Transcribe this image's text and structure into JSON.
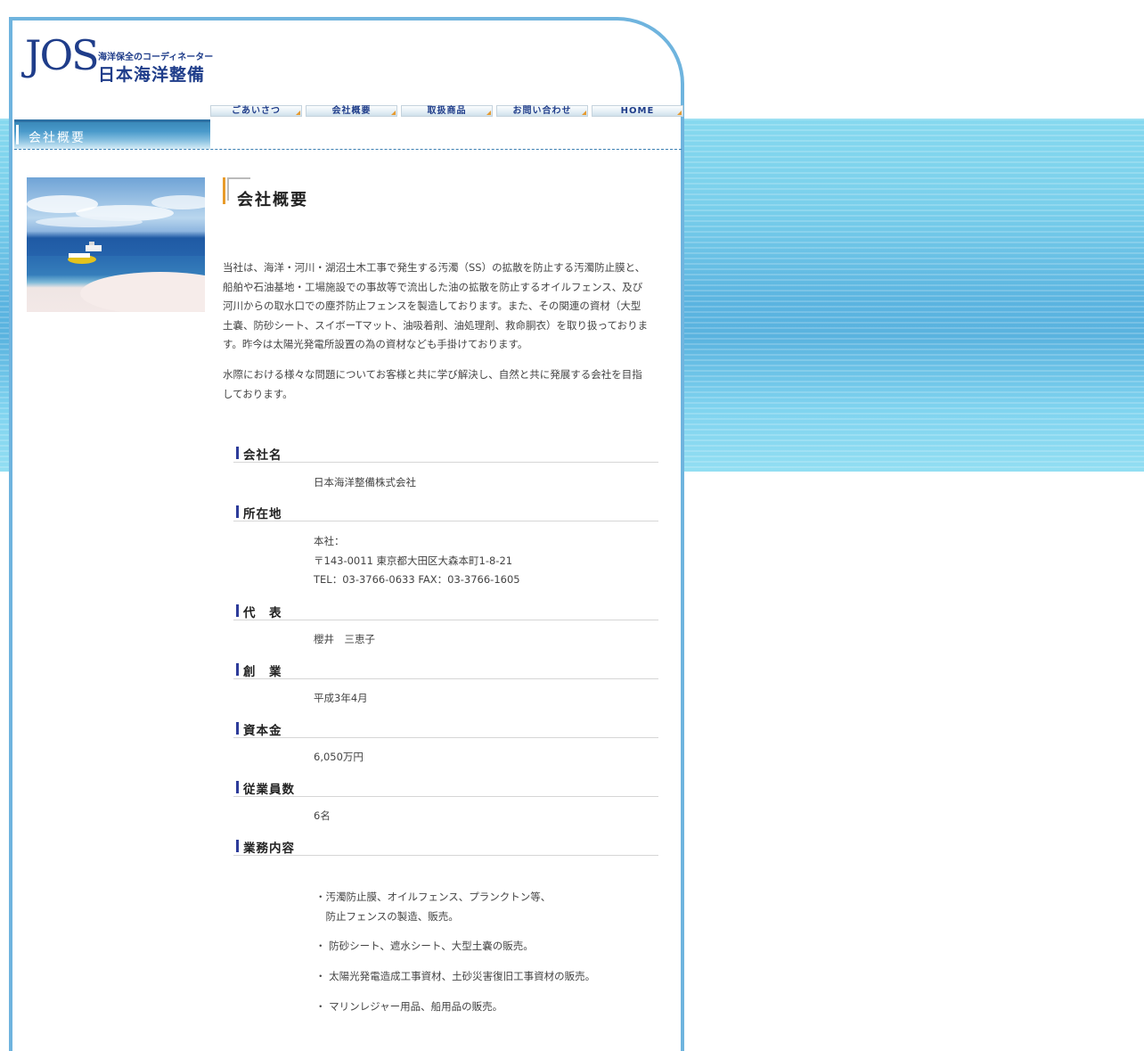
{
  "logo": {
    "mark": "JOS",
    "tagline": "海洋保全のコーディネーター",
    "company": "日本海洋整備"
  },
  "nav": {
    "items": [
      {
        "label": "ごあいさつ"
      },
      {
        "label": "会社概要"
      },
      {
        "label": "取扱商品"
      },
      {
        "label": "お問い合わせ"
      },
      {
        "label": "HOME"
      }
    ]
  },
  "section_header": "会社概要",
  "page_title": "会社概要",
  "intro": {
    "paragraph1": "当社は、海洋・河川・湖沼土木工事で発生する汚濁（SS）の拡散を防止する汚濁防止膜と、\n船舶や石油基地・工場施設での事故等で流出した油の拡散を防止するオイルフェンス、及び\n河川からの取水口での塵芥防止フェンスを製造しております。また、その関連の資材（大型\n土嚢、防砂シート、スイボーTマット、油吸着剤、油処理剤、救命胴衣）を取り扱っておりま\nす。昨今は太陽光発電所設置の為の資材なども手掛けております。",
    "paragraph2": "水際における様々な問題についてお客様と共に学び解決し、自然と共に発展する会社を目指\nしております。"
  },
  "info": {
    "company_name": {
      "label": "会社名",
      "value": "日本海洋整備株式会社"
    },
    "address": {
      "label": "所在地",
      "line1": "本社：",
      "line2": "〒143-0011 東京都大田区大森本町1-8-21",
      "line3": "TEL：03‐3766‐0633 FAX：03‐3766‐1605"
    },
    "representative": {
      "label": "代　表",
      "value": "櫻井　三恵子"
    },
    "founded": {
      "label": "創　業",
      "value": "平成3年4月"
    },
    "capital": {
      "label": "資本金",
      "value": "6,050万円"
    },
    "employees": {
      "label": "従業員数",
      "value": "6名"
    },
    "business": {
      "label": "業務内容",
      "items": [
        "・汚濁防止膜、オイルフェンス、プランクトン等、\n　防止フェンスの製造、販売。",
        "・ 防砂シート、遮水シート、大型土嚢の販売。",
        "・ 太陽光発電造成工事資材、土砂災害復旧工事資材の販売。",
        "・ マリンレジャー用品、船用品の販売。"
      ]
    }
  },
  "colors": {
    "brand_navy": "#1f3d8a",
    "frame_blue": "#6fb4de",
    "accent_orange": "#e89b2a",
    "heading_mark": "#2d3c9a"
  }
}
